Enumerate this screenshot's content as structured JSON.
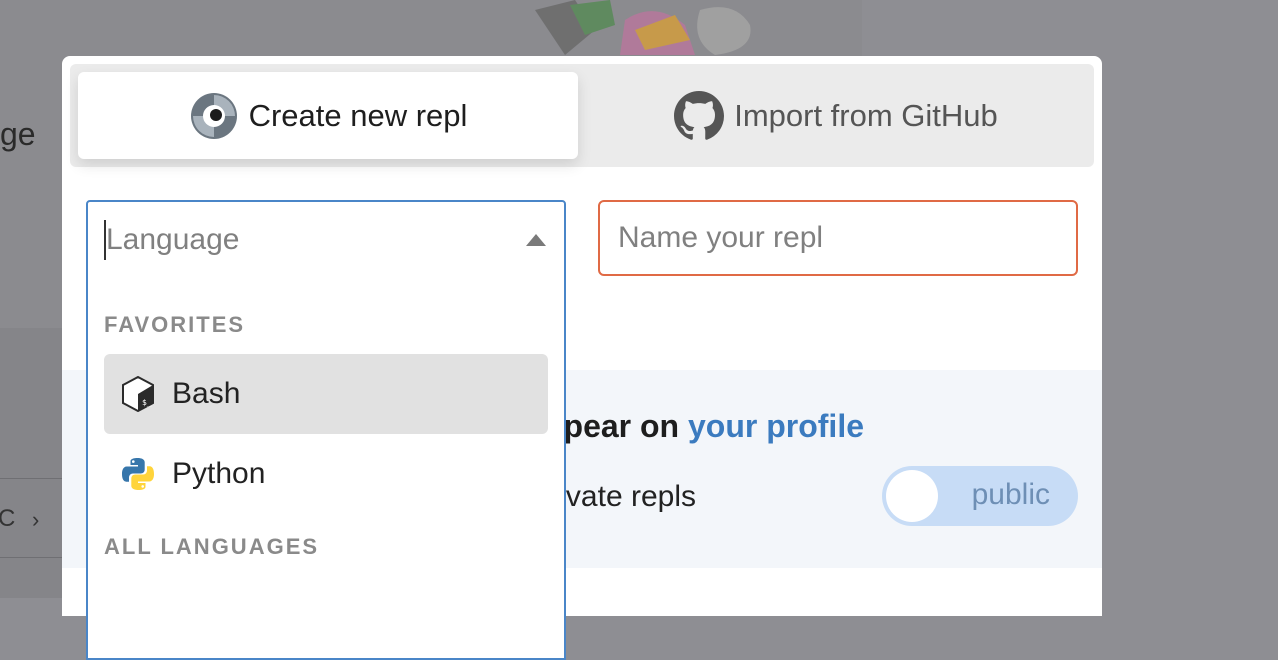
{
  "background": {
    "heading_fragment": "ge",
    "breadcrumb_fragment": "C",
    "breadcrumb_chevron": "›"
  },
  "tabs": [
    {
      "label": "Create new repl",
      "icon": "replit-logo-icon",
      "active": true
    },
    {
      "label": "Import from GitHub",
      "icon": "github-icon",
      "active": false
    }
  ],
  "language": {
    "placeholder": "Language",
    "sections": [
      {
        "label": "FAVORITES",
        "options": [
          {
            "label": "Bash",
            "icon": "bash-icon",
            "selected": true
          },
          {
            "label": "Python",
            "icon": "python-icon",
            "selected": false
          }
        ]
      },
      {
        "label": "ALL LANGUAGES",
        "options": []
      }
    ]
  },
  "name_input": {
    "placeholder": "Name your repl"
  },
  "privacy": {
    "title_prefix": "pear on ",
    "title_link": "your profile",
    "subtitle": "vate repls",
    "toggle_label": "public"
  },
  "colors": {
    "accent_blue": "#3b7bbf",
    "focus_border": "#4a86c8",
    "error_border": "#e06a45",
    "toggle_bg": "#c7dcf6"
  }
}
